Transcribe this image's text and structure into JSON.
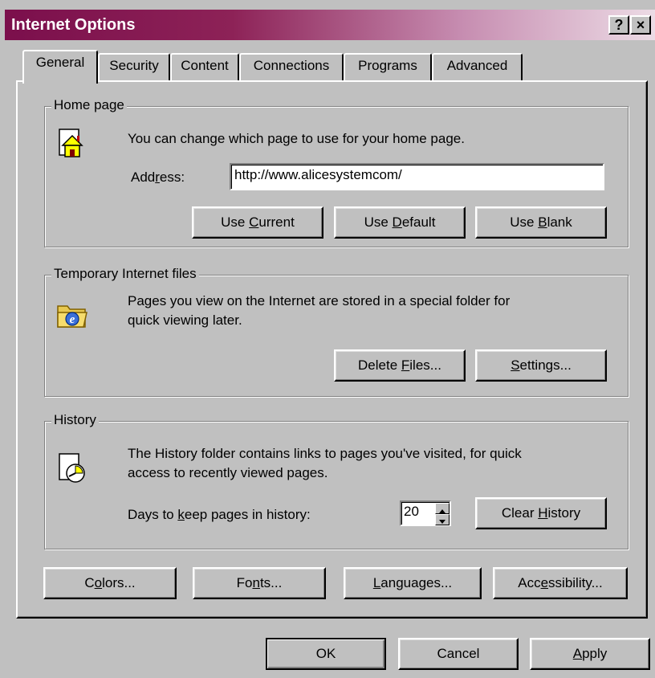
{
  "window": {
    "title": "Internet Options",
    "help_label": "?",
    "close_label": "×"
  },
  "tabs": [
    {
      "label": "General",
      "active": true
    },
    {
      "label": "Security"
    },
    {
      "label": "Content"
    },
    {
      "label": "Connections"
    },
    {
      "label": "Programs"
    },
    {
      "label": "Advanced"
    }
  ],
  "home": {
    "legend": "Home page",
    "description": "You can change which page to use for your home page.",
    "address_label_pre": "Add",
    "address_label_key": "r",
    "address_label_post": "ess:",
    "address_value": "http://www.alicesystemcom/",
    "use_current_pre": "Use ",
    "use_current_key": "C",
    "use_current_post": "urrent",
    "use_default_pre": "Use ",
    "use_default_key": "D",
    "use_default_post": "efault",
    "use_blank_pre": "Use ",
    "use_blank_key": "B",
    "use_blank_post": "lank"
  },
  "temp": {
    "legend": "Temporary Internet files",
    "description_line1": "Pages you view on the Internet are stored in a special folder for",
    "description_line2": "quick viewing later.",
    "delete_pre": "Delete ",
    "delete_key": "F",
    "delete_post": "iles...",
    "settings_key": "S",
    "settings_post": "ettings..."
  },
  "history": {
    "legend": "History",
    "description_line1": "The History folder contains links to pages you've visited, for quick",
    "description_line2": "access to recently viewed pages.",
    "days_label_pre": "Days to ",
    "days_label_key": "k",
    "days_label_post": "eep pages in history:",
    "days_value": "20",
    "clear_pre": "Clear ",
    "clear_key": "H",
    "clear_post": "istory"
  },
  "bottom_buttons": {
    "colors_pre": "C",
    "colors_key": "o",
    "colors_post": "lors...",
    "fonts_pre": "Fo",
    "fonts_key": "n",
    "fonts_post": "ts...",
    "languages_key": "L",
    "languages_post": "anguages...",
    "access_pre": "Acc",
    "access_key": "e",
    "access_post": "ssibility..."
  },
  "dialog_buttons": {
    "ok": "OK",
    "cancel": "Cancel",
    "apply_key": "A",
    "apply_post": "pply"
  },
  "colors": {
    "title_start": "#7b0f4c",
    "face": "#c0c0c0"
  }
}
